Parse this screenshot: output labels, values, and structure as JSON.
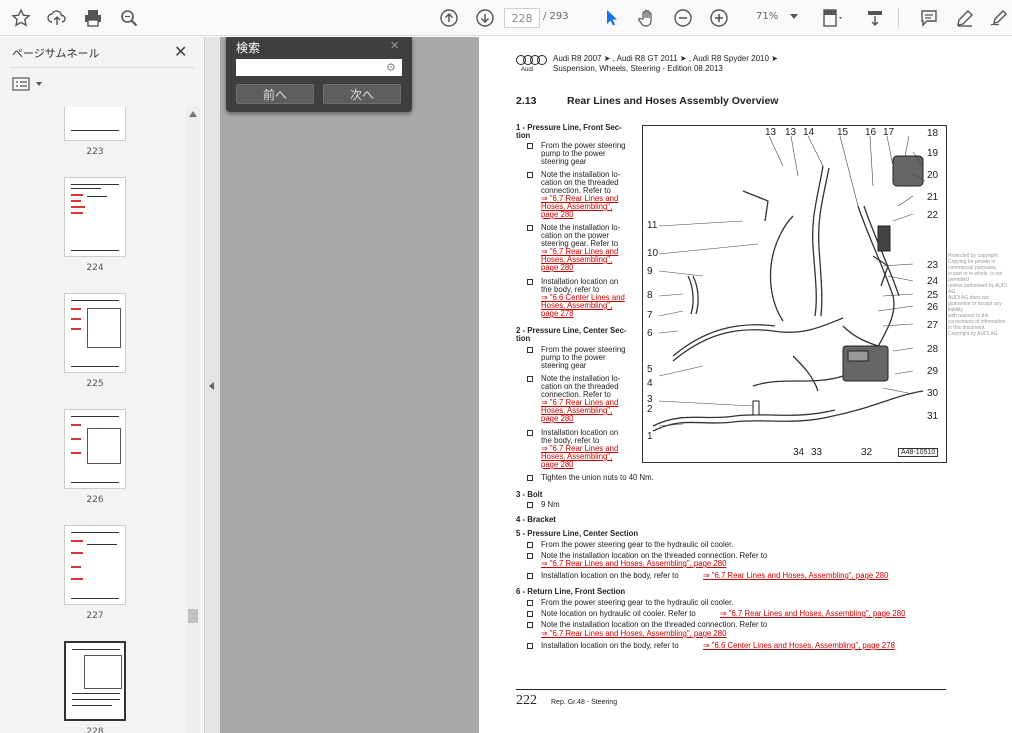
{
  "toolbar": {
    "page_current": "228",
    "page_total": "/ 293",
    "zoom": "71%",
    "icons": [
      "star-icon",
      "upload-icon",
      "print-icon",
      "search-zoom-icon",
      "page-up-icon",
      "page-down-icon",
      "select-cursor-icon",
      "hand-icon",
      "zoom-out-icon",
      "zoom-in-icon",
      "fit-page-icon",
      "scroll-mode-icon",
      "comment-icon",
      "highlight-icon",
      "sign-icon"
    ]
  },
  "sidebar": {
    "title": "ページサムネール",
    "thumbnails": [
      {
        "label": "223"
      },
      {
        "label": "224"
      },
      {
        "label": "225"
      },
      {
        "label": "226"
      },
      {
        "label": "227"
      },
      {
        "label": "228"
      }
    ]
  },
  "find": {
    "title": "検索",
    "prev_label": "前へ",
    "next_label": "次へ"
  },
  "document": {
    "header_line1": "Audi R8 2007 ➤ , Audi R8 GT 2011 ➤ , Audi R8 Spyder 2010 ➤",
    "header_line2": "Suspension, Wheels, Steering - Edition 08.2013",
    "logo_text": "Audi",
    "section_number": "2.13",
    "section_title": "Rear Lines and Hoses Assembly Overview",
    "item1_title_a": "1 - Pressure Line, Front Sec-",
    "item1_title_b": "tion",
    "item1_b1": [
      "From the power steering",
      "pump to the power",
      "steering gear"
    ],
    "item1_b2": [
      "Note the installation lo-",
      "cation on the threaded",
      "connection. Refer to"
    ],
    "item1_b2_link": [
      "⇒ \"6.7 Rear Lines and",
      "Hoses, Assembling\",",
      "page 280"
    ],
    "item1_b3": [
      "Note the installation lo-",
      "cation on the power",
      "steering gear. Refer to"
    ],
    "item1_b3_link": [
      "⇒ \"6.7 Rear Lines and",
      "Hoses, Assembling\",",
      "page 280"
    ],
    "item1_b4": [
      "Installation location on",
      "the body, refer to"
    ],
    "item1_b4_link": [
      "⇒ \"6.6 Center Lines and",
      "Hoses, Assembling\",",
      "page 278"
    ],
    "item2_title_a": "2 - Pressure Line, Center Sec-",
    "item2_title_b": "tion",
    "item2_b1": [
      "From the power steering",
      "pump to the power",
      "steering gear"
    ],
    "item2_b2": [
      "Note the installation lo-",
      "cation on the threaded",
      "connection. Refer to"
    ],
    "item2_b2_link": [
      "⇒ \"6.7 Rear Lines and",
      "Hoses, Assembling\",",
      "page 280"
    ],
    "item2_b3": [
      "Installation location on",
      "the body, refer to"
    ],
    "item2_b3_link": [
      "⇒ \"6.7 Rear Lines and",
      "Hoses, Assembling\",",
      "page 280"
    ],
    "item2_b4": "Tighten the union nuts to 40 Nm.",
    "item3_title": "3 - Bolt",
    "item3_b1": "9 Nm",
    "item4_title": "4 - Bracket",
    "item5_title": "5 - Pressure Line, Center Section",
    "item5_b1": "From the power steering gear to the hydraulic oil cooler.",
    "item5_b2": "Note the installation location on the threaded connection. Refer to",
    "item5_b2_link": "⇒ \"6.7 Rear Lines and Hoses, Assembling\", page 280",
    "item5_b3": "Installation location on the body, refer to",
    "item5_b3_link": "⇒ \"6.7 Rear Lines and Hoses, Assembling\", page 280",
    "item6_title": "6 - Return Line, Front Section",
    "item6_b1": "From the power steering gear to the hydraulic oil cooler.",
    "item6_b2": "Note location on hydraulic oil cooler. Refer to",
    "item6_b2_link": "⇒ \"6.7 Rear Lines and Hoses, Assembling\", page 280",
    "item6_b3": "Note the installation location on the threaded connection. Refer to",
    "item6_b3_link": "⇒ \"6.7 Rear Lines and Hoses, Assembling\", page 280",
    "item6_b4": "Installation location on the body, refer to",
    "item6_b4_link": "⇒ \"6.6 Center Lines and Hoses, Assembling\", page 278",
    "diagram_id": "A48-10510",
    "callouts_top": [
      "13",
      "13",
      "14",
      "15",
      "16",
      "17",
      "18"
    ],
    "callouts_right": [
      "19",
      "20",
      "21",
      "22",
      "23",
      "24",
      "25",
      "26",
      "27",
      "28",
      "29",
      "30",
      "31"
    ],
    "callouts_left": [
      "11",
      "10",
      "9",
      "8",
      "7",
      "6",
      "5",
      "4",
      "3",
      "2",
      "1"
    ],
    "callouts_bottom": [
      "34",
      "33",
      "32"
    ],
    "side_note": [
      "Protected by copyright.",
      "Copying for private or commercial purposes,",
      "in part or in whole, is not permitted",
      "unless authorised by AUDI AG.",
      "AUDI AG does not guarantee or accept any liability",
      "with respect to the correctness of information in this document.",
      "Copyright by AUDI AG."
    ],
    "footer_page": "222",
    "footer_text": "Rep. Gr.48 - Steering"
  }
}
